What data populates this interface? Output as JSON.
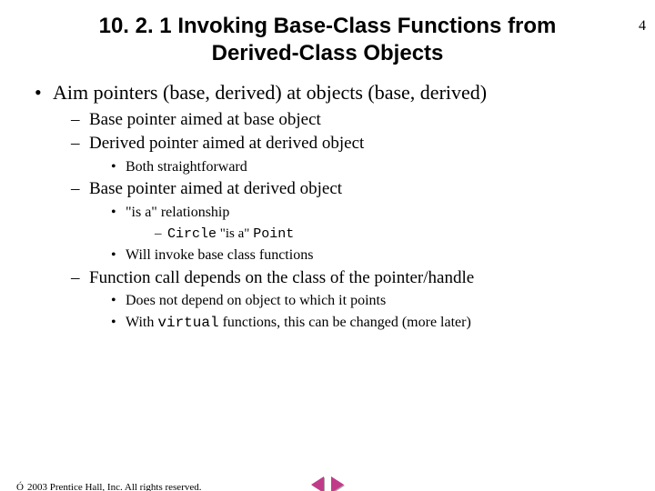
{
  "pageNumber": "4",
  "title": "10. 2. 1 Invoking Base-Class Functions from Derived-Class Objects",
  "bullets": {
    "l1_0": "Aim pointers (base, derived) at objects (base, derived)",
    "l2_0": "Base pointer aimed at base object",
    "l2_1": "Derived pointer aimed at derived object",
    "l3_0": "Both straightforward",
    "l2_2": "Base pointer aimed at derived object",
    "l3_1a": "\"is a\" relationship",
    "l4_0_code1": "Circle",
    "l4_0_mid": " \"is a\" ",
    "l4_0_code2": "Point",
    "l3_1b": "Will invoke base class functions",
    "l2_3": "Function call depends on the class of the pointer/handle",
    "l3_2": "Does not depend on object to which it points",
    "l3_3a": "With ",
    "l3_3code": "virtual",
    "l3_3b": " functions, this can be changed (more later)"
  },
  "footer": {
    "symbol": "Ó",
    "text": " 2003 Prentice Hall, Inc. All rights reserved."
  }
}
